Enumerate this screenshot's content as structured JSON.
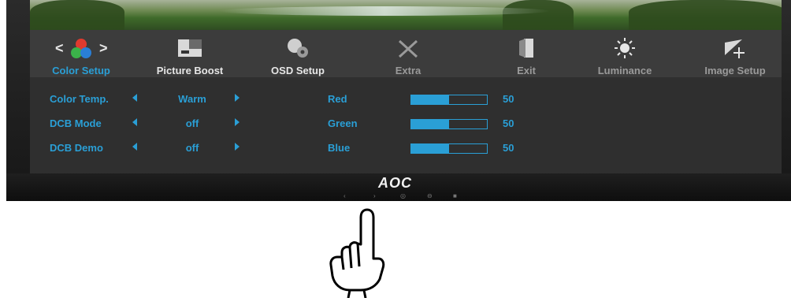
{
  "brand": "AOC",
  "menu": {
    "tabs": [
      {
        "label": "Color Setup",
        "icon": "color-setup-icon"
      },
      {
        "label": "Picture Boost",
        "icon": "picture-boost-icon"
      },
      {
        "label": "OSD Setup",
        "icon": "osd-setup-icon"
      },
      {
        "label": "Extra",
        "icon": "extra-tools-icon"
      },
      {
        "label": "Exit",
        "icon": "exit-door-icon"
      },
      {
        "label": "Luminance",
        "icon": "luminance-sun-icon"
      },
      {
        "label": "Image Setup",
        "icon": "image-setup-icon"
      }
    ]
  },
  "settings": [
    {
      "name": "Color Temp.",
      "value": "Warm"
    },
    {
      "name": "DCB Mode",
      "value": "off"
    },
    {
      "name": "DCB Demo",
      "value": "off"
    }
  ],
  "channels": [
    {
      "name": "Red",
      "value": "50",
      "level": 0.5
    },
    {
      "name": "Green",
      "value": "50",
      "level": 0.5
    },
    {
      "name": "Blue",
      "value": "50",
      "level": 0.5
    }
  ],
  "colors": {
    "accent": "#2a9fd6",
    "menu_bg": "#3c3c3c",
    "content_bg": "#2f2f2f"
  }
}
